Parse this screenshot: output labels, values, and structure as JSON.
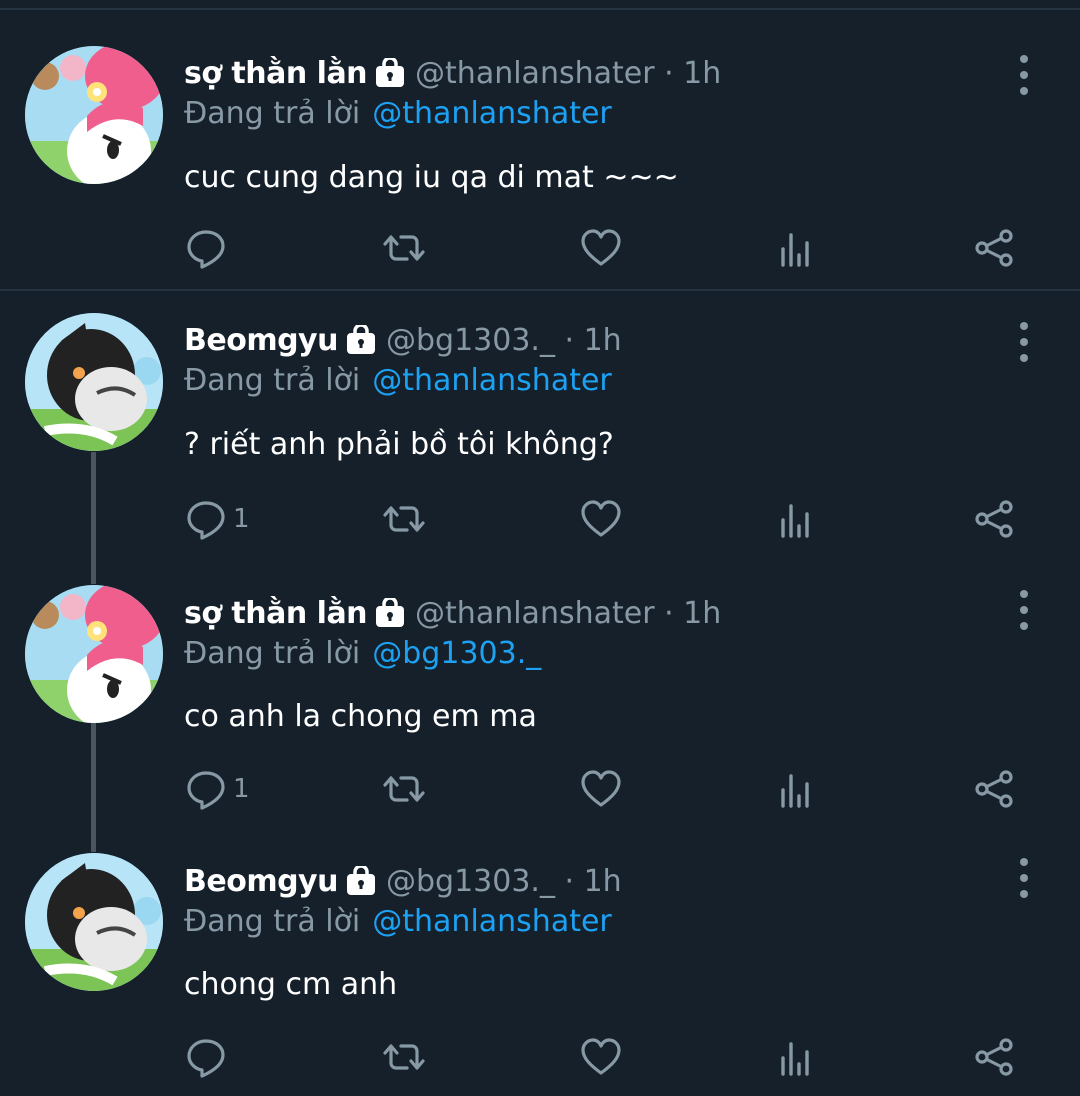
{
  "tweets": [
    {
      "name": "sợ thằn lằn",
      "handle": "@thanlanshater · 1h",
      "reply_prefix": "Đang trả lời",
      "reply_to": "@thanlanshater",
      "text": "cuc cung dang iu qa di mat ~~~",
      "reply_count": "",
      "avatar": "pink-bunny"
    },
    {
      "name": "Beomgyu",
      "handle": "@bg1303._ · 1h",
      "reply_prefix": "Đang trả lời",
      "reply_to": "@thanlanshater",
      "text": "? riết anh phải bồ tôi không?",
      "reply_count": "1",
      "avatar": "black-bunny"
    },
    {
      "name": "sợ thằn lằn",
      "handle": "@thanlanshater · 1h",
      "reply_prefix": "Đang trả lời",
      "reply_to": "@bg1303._",
      "text": "co anh la chong em ma",
      "reply_count": "1",
      "avatar": "pink-bunny"
    },
    {
      "name": "Beomgyu",
      "handle": "@bg1303._ · 1h",
      "reply_prefix": "Đang trả lời",
      "reply_to": "@thanlanshater",
      "text": "chong cm anh",
      "reply_count": "",
      "avatar": "black-bunny"
    }
  ],
  "icons": [
    "lock-icon",
    "reply-icon",
    "retweet-icon",
    "like-icon",
    "analytics-icon",
    "share-icon",
    "more-icon"
  ],
  "colors": {
    "background": "#15202b",
    "text": "#ffffff",
    "secondary": "#8899a6",
    "link": "#1da1f2",
    "divider": "#253341"
  }
}
